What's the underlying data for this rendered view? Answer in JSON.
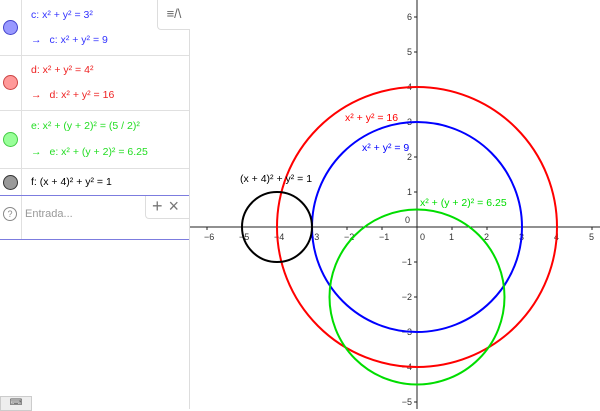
{
  "algebra": {
    "items": [
      {
        "definition": "c: x² + y² = 3²",
        "output": "c: x² + y² = 9",
        "color": "#0000ff",
        "marble": "#9999ff"
      },
      {
        "definition": "d: x² + y² = 4²",
        "output": "d: x² + y² = 16",
        "color": "#ff0000",
        "marble": "#ff9999"
      },
      {
        "definition": "e: x² + (y + 2)² = (5 / 2)²",
        "output": "e: x² + (y + 2)² = 6.25",
        "color": "#00dd00",
        "marble": "#99ff99"
      },
      {
        "definition": "f: (x + 4)² + y² = 1",
        "color": "#000000",
        "marble": "#999999"
      }
    ],
    "output_arrow": "→",
    "input_placeholder": "Entrada...",
    "help_icon": "?",
    "add_label": "+",
    "close_label": "×",
    "style_bar_icon": "≡/\\"
  },
  "graphics": {
    "labels": {
      "c": "x² + y² = 9",
      "d": "x² + y² = 16",
      "e": "x² + (y + 2)² = 6.25",
      "f": "(x + 4)² + y² = 1"
    },
    "x_ticks": [
      -6,
      -5,
      -4,
      -3,
      -2,
      -1,
      0,
      1,
      2,
      3,
      4,
      5
    ],
    "y_ticks": [
      -5,
      -4,
      -3,
      -2,
      -1,
      1,
      2,
      3,
      4,
      5,
      6
    ],
    "origin_label": "0",
    "circles": [
      {
        "name": "c",
        "cx": 0,
        "cy": 0,
        "r": 3,
        "color": "#0000ff"
      },
      {
        "name": "d",
        "cx": 0,
        "cy": 0,
        "r": 4,
        "color": "#ff0000"
      },
      {
        "name": "e",
        "cx": 0,
        "cy": -2,
        "r": 2.5,
        "color": "#00dd00"
      },
      {
        "name": "f",
        "cx": -4,
        "cy": 0,
        "r": 1,
        "color": "#000000"
      }
    ]
  }
}
